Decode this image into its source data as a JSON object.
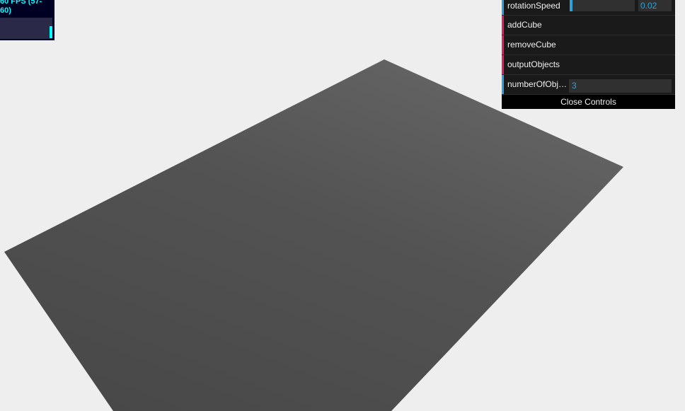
{
  "stats": {
    "fps_text": "60 FPS (57-60)",
    "fps_value": 60,
    "fps_min": 57,
    "fps_max": 60,
    "text_color": "#00ffff",
    "graph_color": "#00ffff"
  },
  "scene": {
    "background_color": "#eeeeee",
    "plane_color": "#555555"
  },
  "gui": {
    "accent_number": "#2fa1d6",
    "accent_function": "#e61d5f",
    "controls": [
      {
        "label": "rotationSpeed",
        "type": "number",
        "value": "0.02",
        "slider_fraction": 0.02
      },
      {
        "label": "addCube",
        "type": "function"
      },
      {
        "label": "removeCube",
        "type": "function"
      },
      {
        "label": "outputObjects",
        "type": "function"
      },
      {
        "label": "numberOfObjects",
        "type": "number",
        "value": "3"
      }
    ],
    "close_label": "Close Controls"
  }
}
